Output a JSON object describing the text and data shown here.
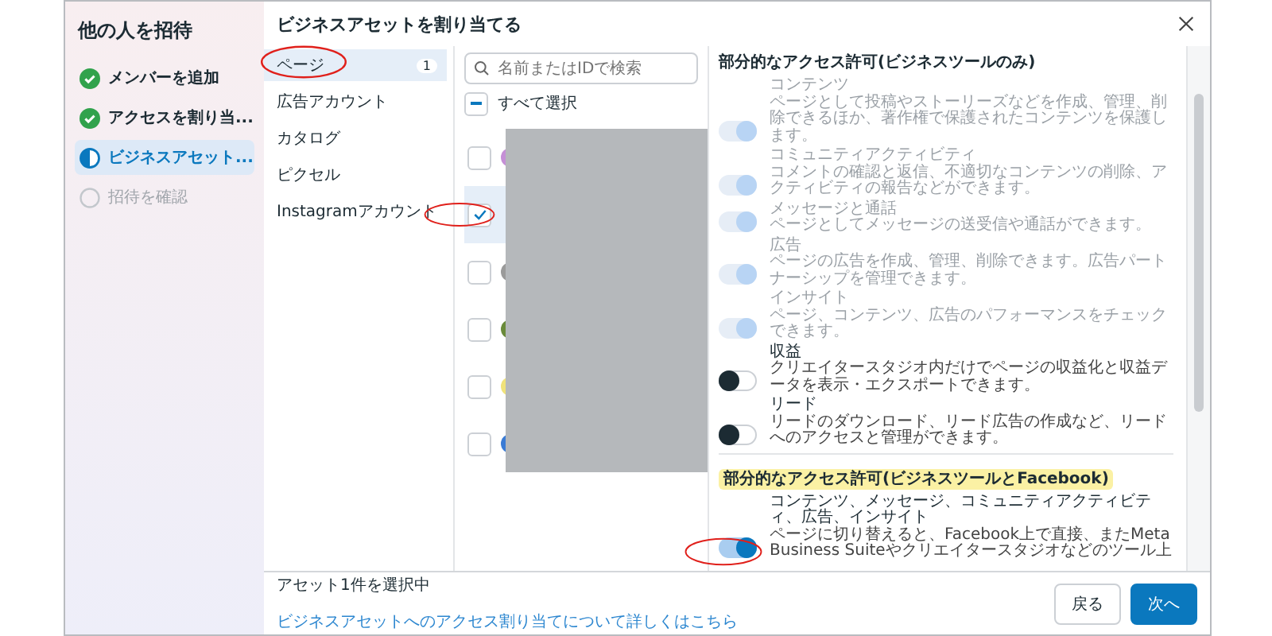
{
  "sidebar": {
    "title": "他の人を招待",
    "steps": [
      {
        "label": "メンバーを追加",
        "kind": "done"
      },
      {
        "label": "アクセスを割り当...",
        "kind": "done"
      },
      {
        "label": "ビジネスアセット...",
        "kind": "current"
      },
      {
        "label": "招待を確認",
        "kind": "pending"
      }
    ]
  },
  "dialog": {
    "title": "ビジネスアセットを割り当てる"
  },
  "categories": [
    {
      "label": "ページ",
      "selected": true,
      "count": "1",
      "highlight": true
    },
    {
      "label": "広告アカウント",
      "selected": false,
      "highlight": false
    },
    {
      "label": "カタログ",
      "selected": false,
      "highlight": false
    },
    {
      "label": "ピクセル",
      "selected": false,
      "highlight": false
    },
    {
      "label": "Instagramアカウント",
      "selected": false,
      "highlight": false
    }
  ],
  "assets": {
    "search_placeholder": "名前またはIDで検索",
    "select_all": "すべて選択",
    "select_all_indeterminate": true,
    "rows": [
      {
        "checked": false,
        "highlight": false,
        "color": "#c58fd6"
      },
      {
        "checked": true,
        "highlight": true
      },
      {
        "checked": false,
        "highlight": false,
        "color": "#9a9a9a"
      },
      {
        "checked": false,
        "highlight": false,
        "color": "#6a8a3a"
      },
      {
        "checked": false,
        "highlight": false,
        "color": "#f0e27a"
      },
      {
        "checked": false,
        "highlight": false,
        "color": "#3a7bd5"
      }
    ]
  },
  "permissions": {
    "sections": [
      {
        "heading": "部分的なアクセス許可(ビジネスツールのみ)",
        "marked": false,
        "items": [
          {
            "title": "コンテンツ",
            "description": "ページとして投稿やストーリーズなどを作成、管理、削除できるほか、著作権で保護されたコンテンツを保護します。",
            "on": true,
            "disabled": true,
            "highlight": false
          },
          {
            "title": "コミュニティアクティビティ",
            "description": "コメントの確認と返信、不適切なコンテンツの削除、アクティビティの報告などができます。",
            "on": true,
            "disabled": true,
            "highlight": false
          },
          {
            "title": "メッセージと通話",
            "description": "ページとしてメッセージの送受信や通話ができます。",
            "on": true,
            "disabled": true,
            "highlight": false
          },
          {
            "title": "広告",
            "description": "ページの広告を作成、管理、削除できます。広告パートナーシップを管理できます。",
            "on": true,
            "disabled": true,
            "highlight": false
          },
          {
            "title": "インサイト",
            "description": "ページ、コンテンツ、広告のパフォーマンスをチェックできます。",
            "on": true,
            "disabled": true,
            "highlight": false
          },
          {
            "title": "収益",
            "description": "クリエイタースタジオ内だけでページの収益化と収益データを表示・エクスポートできます。",
            "on": false,
            "disabled": false,
            "highlight": false
          },
          {
            "title": "リード",
            "description": "リードのダウンロード、リード広告の作成など、リードへのアクセスと管理ができます。",
            "on": false,
            "disabled": false,
            "highlight": false
          }
        ]
      },
      {
        "heading": "部分的なアクセス許可(ビジネスツールとFacebook)",
        "marked": true,
        "items": [
          {
            "title": "コンテンツ、メッセージ、コミュニティアクティビティ、広告、インサイト",
            "description": "ページに切り替えると、Facebook上で直接、またMeta Business Suiteやクリエイタースタジオなどのツール上",
            "on": true,
            "disabled": false,
            "highlight": true
          }
        ]
      }
    ]
  },
  "footer": {
    "status": "アセット1件を選択中",
    "link": "ビジネスアセットへのアクセス割り当てについて詳しくはこちら",
    "buttons": [
      {
        "label": "戻る",
        "kind": "secondary"
      },
      {
        "label": "次へ",
        "kind": "primary"
      }
    ]
  }
}
